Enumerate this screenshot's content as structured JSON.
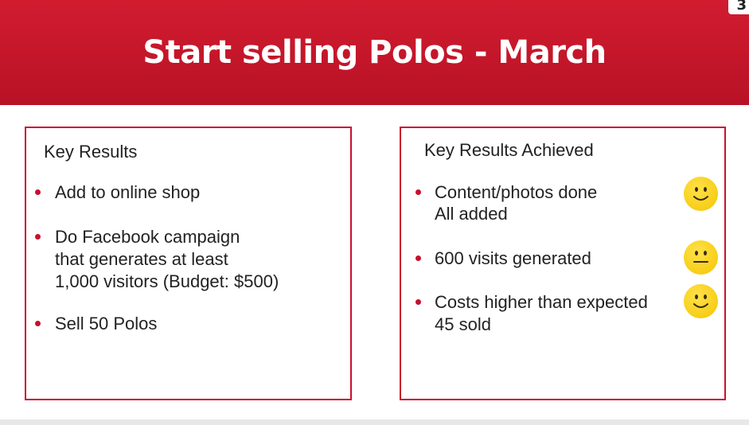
{
  "slide": {
    "title": "Start selling Polos - March",
    "corner_mark": "3"
  },
  "left_panel": {
    "heading": "Key Results",
    "items": [
      {
        "lines": [
          "Add to online shop"
        ]
      },
      {
        "lines": [
          "Do Facebook campaign",
          "that generates at least",
          "1,000 visitors (Budget: $500)"
        ]
      },
      {
        "lines": [
          "Sell 50 Polos"
        ]
      }
    ]
  },
  "right_panel": {
    "heading": "Key Results Achieved",
    "items": [
      {
        "lines": [
          "Content/photos done",
          "All added"
        ],
        "status_icon": "smiley-happy-icon"
      },
      {
        "lines": [
          "600 visits generated"
        ],
        "status_icon": "smiley-neutral-icon"
      },
      {
        "lines": [
          "Costs higher than expected",
          "45 sold"
        ],
        "status_icon": "smiley-happy-icon"
      }
    ]
  },
  "colors": {
    "header_red": "#c4162a",
    "border_red": "#c8102e",
    "bullet_red": "#c8102e",
    "smiley_yellow": "#f8cf1a",
    "text_dark": "#222222"
  }
}
